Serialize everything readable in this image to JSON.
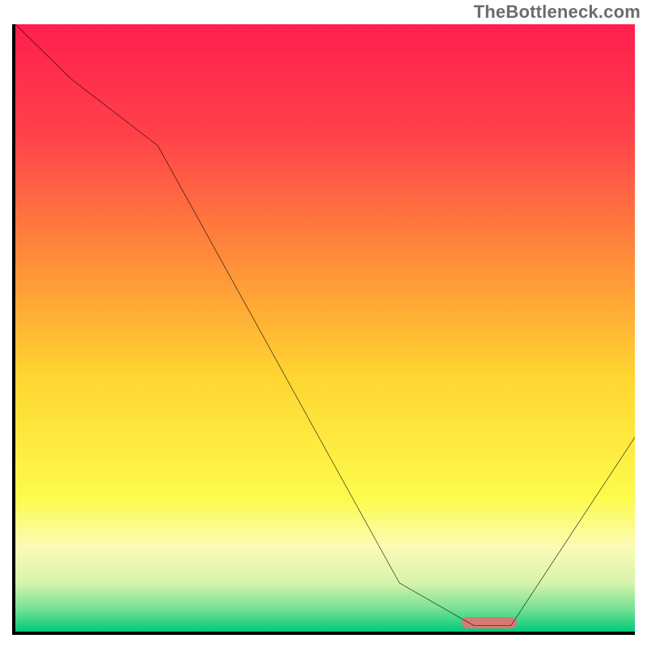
{
  "watermark": "TheBottleneck.com",
  "chart_data": {
    "type": "line",
    "title": "",
    "xlabel": "",
    "ylabel": "",
    "xlim": [
      0,
      100
    ],
    "ylim": [
      0,
      100
    ],
    "x": [
      0,
      9,
      23,
      62,
      74,
      80,
      100
    ],
    "values": [
      100,
      91,
      80,
      8,
      1,
      1,
      32
    ],
    "gradient_stops": [
      {
        "pos": 0.0,
        "color": "#ff1e4e"
      },
      {
        "pos": 0.18,
        "color": "#ff414a"
      },
      {
        "pos": 0.38,
        "color": "#ff8a3a"
      },
      {
        "pos": 0.58,
        "color": "#ffd531"
      },
      {
        "pos": 0.78,
        "color": "#fdfb4c"
      },
      {
        "pos": 0.86,
        "color": "#fbfbb5"
      },
      {
        "pos": 0.92,
        "color": "#d7f4ac"
      },
      {
        "pos": 0.965,
        "color": "#6fe092"
      },
      {
        "pos": 1.0,
        "color": "#00c97a"
      }
    ],
    "marker": {
      "x_start": 72,
      "x_end": 81,
      "y": 1,
      "color": "#d87a74"
    }
  }
}
